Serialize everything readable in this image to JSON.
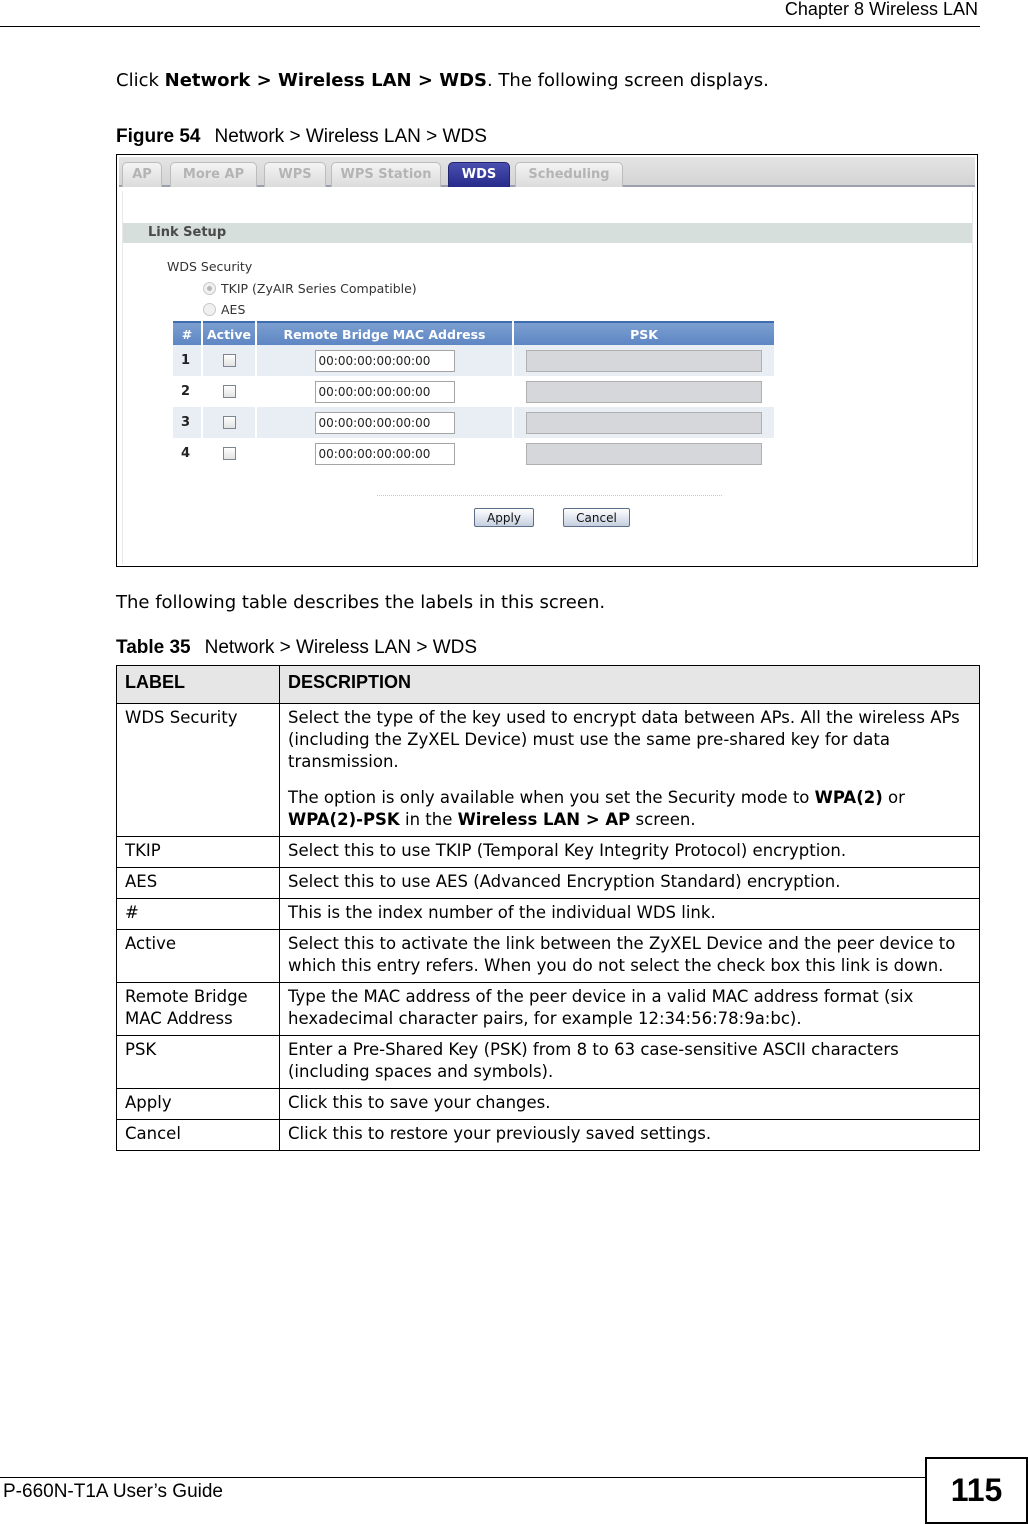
{
  "header": {
    "chapter": "Chapter 8 Wireless LAN"
  },
  "intro": {
    "prefix": "Click ",
    "path": "Network > Wireless LAN > WDS",
    "suffix": ". The following screen displays."
  },
  "figure": {
    "label": "Figure 54",
    "title": "Network > Wireless LAN > WDS",
    "tabs": [
      {
        "label": "AP",
        "active": false
      },
      {
        "label": "More AP",
        "active": false
      },
      {
        "label": "WPS",
        "active": false
      },
      {
        "label": "WPS Station",
        "active": false
      },
      {
        "label": "WDS",
        "active": true
      },
      {
        "label": "Scheduling",
        "active": false
      }
    ],
    "section_title": "Link Setup",
    "security_label": "WDS Security",
    "security_options": [
      {
        "label": "TKIP (ZyAIR Series Compatible)",
        "selected": true
      },
      {
        "label": "AES",
        "selected": false
      }
    ],
    "columns": [
      "#",
      "Active",
      "Remote Bridge MAC Address",
      "PSK"
    ],
    "rows": [
      {
        "index": "1",
        "active": false,
        "mac": "00:00:00:00:00:00",
        "psk": ""
      },
      {
        "index": "2",
        "active": false,
        "mac": "00:00:00:00:00:00",
        "psk": ""
      },
      {
        "index": "3",
        "active": false,
        "mac": "00:00:00:00:00:00",
        "psk": ""
      },
      {
        "index": "4",
        "active": false,
        "mac": "00:00:00:00:00:00",
        "psk": ""
      }
    ],
    "apply_label": "Apply",
    "cancel_label": "Cancel",
    "colors": {
      "active_tab": "#2e3394",
      "header_bar": "#6a90c8",
      "section_bar": "#d6dfdc"
    }
  },
  "table_intro": "The following table describes the labels in this screen.",
  "table": {
    "label": "Table 35",
    "title": "Network > Wireless LAN > WDS",
    "headers": [
      "LABEL",
      "DESCRIPTION"
    ],
    "rows": [
      {
        "label": "WDS Security",
        "desc1": "Select the type of the key used to encrypt data between APs. All the wireless APs (including the ZyXEL Device) must use the same pre-shared key for data transmission.",
        "desc2_a": "The option is only available when you set the Security mode to ",
        "desc2_b1": "WPA(2)",
        "desc2_c": " or ",
        "desc2_b2": "WPA(2)-PSK",
        "desc2_d": " in the ",
        "desc2_b3": "Wireless LAN > AP",
        "desc2_e": " screen."
      },
      {
        "label": "TKIP",
        "desc": "Select this to use TKIP (Temporal Key Integrity Protocol) encryption."
      },
      {
        "label": "AES",
        "desc": "Select this to use AES (Advanced Encryption Standard) encryption."
      },
      {
        "label": "#",
        "desc": "This is the index number of the individual WDS link."
      },
      {
        "label": "Active",
        "desc": "Select this to activate the link between the ZyXEL Device and the peer device to which this entry refers. When you do not select the check box this link is down."
      },
      {
        "label": "Remote Bridge MAC Address",
        "desc": "Type the MAC address of the peer device in a valid MAC address format (six hexadecimal character pairs, for example 12:34:56:78:9a:bc)."
      },
      {
        "label": "PSK",
        "desc": "Enter a Pre-Shared Key (PSK) from 8 to 63 case-sensitive ASCII characters (including spaces and symbols)."
      },
      {
        "label": "Apply",
        "desc": "Click this to save your changes."
      },
      {
        "label": "Cancel",
        "desc": "Click this to restore your previously saved settings."
      }
    ]
  },
  "footer": {
    "title": "P-660N-T1A User’s Guide",
    "page_number": "115"
  }
}
